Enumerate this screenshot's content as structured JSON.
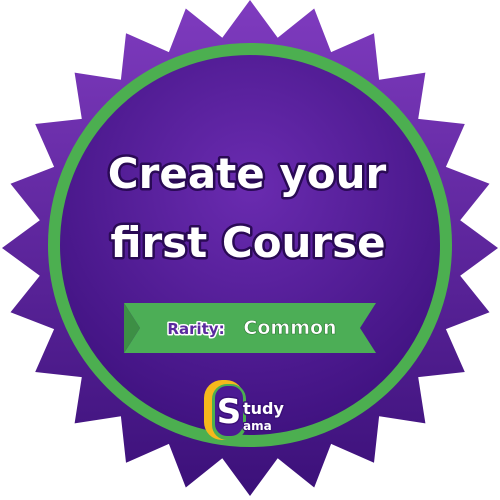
{
  "badge": {
    "title_line1": "Create your",
    "title_line2": "first Course",
    "rarity_label": "Rarity:",
    "rarity_value": "Common"
  },
  "logo": {
    "initial": "S",
    "top_text": "tudy",
    "bottom_text": "ama"
  },
  "colors": {
    "badge_purple_light": "#7f3bbf",
    "badge_purple_dark": "#3b1079",
    "ring_green": "#4caf50",
    "ribbon_green": "#4cae56",
    "ribbon_text_purple": "#5a2a9e",
    "logo_yellow": "#f6b81c",
    "text_white": "#ffffff"
  },
  "icons": {
    "badge_shape": "starburst-seal-icon",
    "logo_mark": "study-sama-logo-icon"
  }
}
